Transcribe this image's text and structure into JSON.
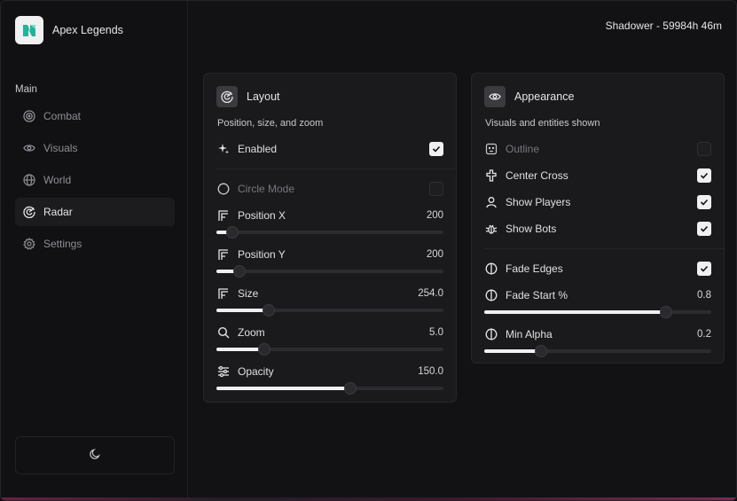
{
  "app": {
    "name": "Apex Legends"
  },
  "user": {
    "status": "Shadower - 59984h 46m"
  },
  "sidebar": {
    "section": "Main",
    "items": [
      {
        "label": "Combat",
        "icon": "target-icon"
      },
      {
        "label": "Visuals",
        "icon": "eye-icon"
      },
      {
        "label": "World",
        "icon": "globe-icon"
      },
      {
        "label": "Radar",
        "icon": "radar-icon",
        "active": true
      },
      {
        "label": "Settings",
        "icon": "gear-icon"
      }
    ],
    "theme_icon": "moon-icon"
  },
  "layout_card": {
    "title": "Layout",
    "subtitle": "Position, size, and zoom",
    "enabled": {
      "label": "Enabled",
      "checked": true
    },
    "circle_mode": {
      "label": "Circle Mode",
      "checked": false
    },
    "position_x": {
      "label": "Position X",
      "value": "200",
      "fraction": 0.07
    },
    "position_y": {
      "label": "Position Y",
      "value": "200",
      "fraction": 0.1
    },
    "size": {
      "label": "Size",
      "value": "254.0",
      "fraction": 0.23
    },
    "zoom": {
      "label": "Zoom",
      "value": "5.0",
      "fraction": 0.21
    },
    "opacity": {
      "label": "Opacity",
      "value": "150.0",
      "fraction": 0.59
    }
  },
  "appearance_card": {
    "title": "Appearance",
    "subtitle": "Visuals and entities shown",
    "outline": {
      "label": "Outline",
      "checked": false
    },
    "center_cross": {
      "label": "Center Cross",
      "checked": true
    },
    "show_players": {
      "label": "Show Players",
      "checked": true
    },
    "show_bots": {
      "label": "Show Bots",
      "checked": true
    },
    "fade_edges": {
      "label": "Fade Edges",
      "checked": true
    },
    "fade_start": {
      "label": "Fade Start %",
      "value": "0.8",
      "fraction": 0.8
    },
    "min_alpha": {
      "label": "Min Alpha",
      "value": "0.2",
      "fraction": 0.25
    }
  }
}
